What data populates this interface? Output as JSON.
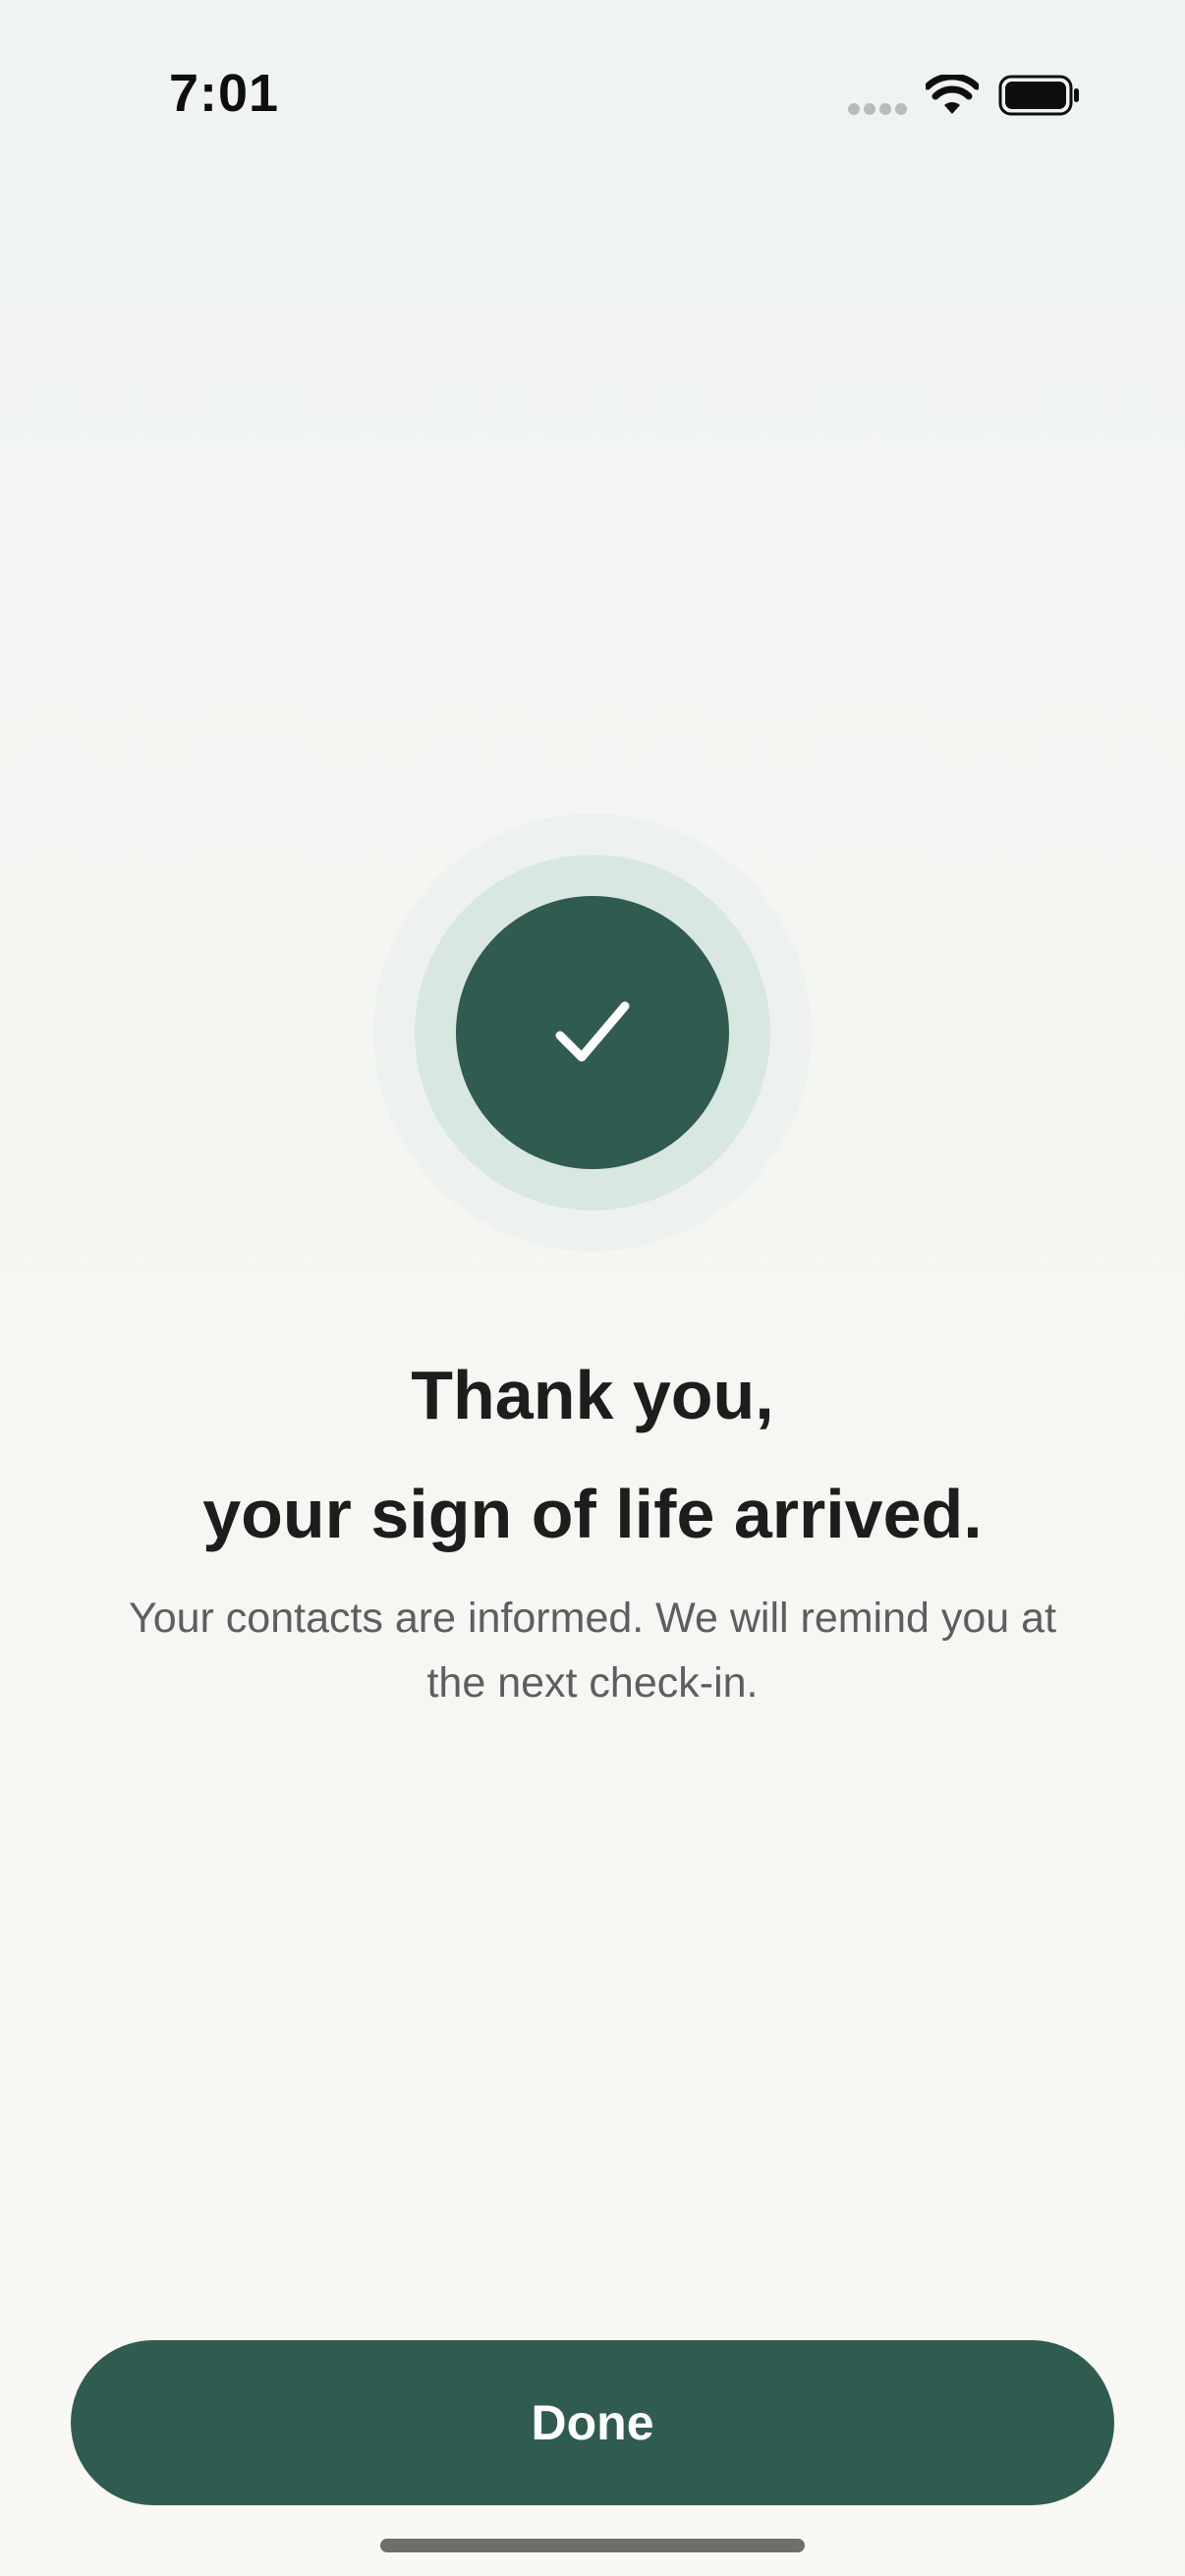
{
  "status_bar": {
    "time": "7:01",
    "icons": [
      "signal-dots-icon",
      "wifi-icon",
      "battery-icon"
    ]
  },
  "confirmation": {
    "icon": "check-icon",
    "title_line_1": "Thank you,",
    "title_line_2": "your sign of life arrived.",
    "message_line_1": "Your contacts are informed. We will remind you at",
    "message_line_2": "the next check-in."
  },
  "actions": {
    "done_label": "Done"
  },
  "colors": {
    "accent": "#305b51",
    "ring_mid": "#d9e7e1",
    "ring_outer": "#edf2ee",
    "text_primary": "#1b1e1c",
    "text_secondary": "#5b605d"
  }
}
